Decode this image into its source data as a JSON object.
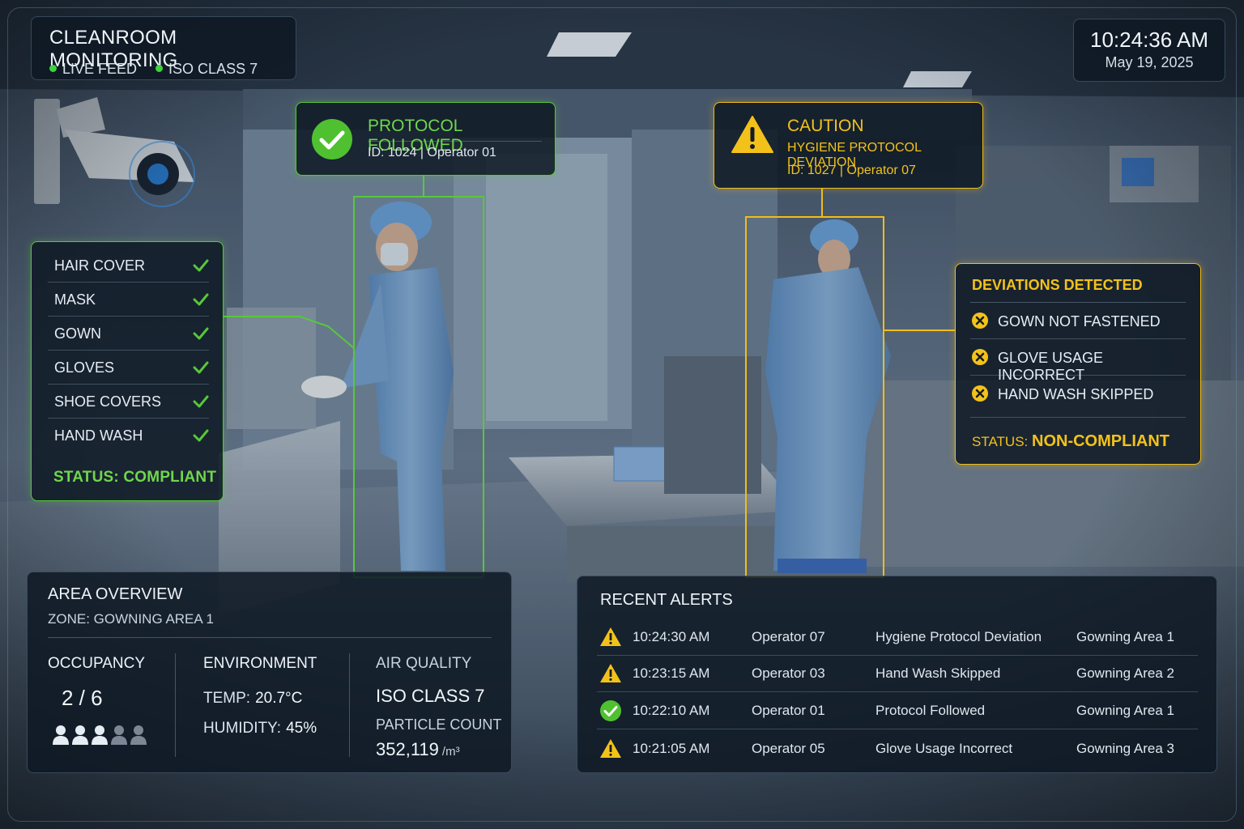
{
  "header": {
    "title": "CLEANROOM MONITORING",
    "tags": [
      "LIVE FEED",
      "ISO CLASS 7"
    ]
  },
  "clock": {
    "time": "10:24:36 AM",
    "date": "May 19, 2025"
  },
  "colors": {
    "compliant": "#6fd74b",
    "caution": "#f3c21a",
    "panel": "#0e1824"
  },
  "operator_ok": {
    "title": "PROTOCOL FOLLOWED",
    "subtitle": "ID: 1024 | Operator 01",
    "icon": "check-circle-icon"
  },
  "operator_warn": {
    "title": "CAUTION",
    "message": "HYGIENE PROTOCOL DEVIATION",
    "subtitle": "ID: 1027 | Operator 07",
    "icon": "warning-triangle-icon"
  },
  "checklist": {
    "items": [
      {
        "label": "HAIR COVER",
        "icon": "check-icon"
      },
      {
        "label": "MASK",
        "icon": "check-icon"
      },
      {
        "label": "GOWN",
        "icon": "check-icon"
      },
      {
        "label": "GLOVES",
        "icon": "check-icon"
      },
      {
        "label": "SHOE COVERS",
        "icon": "check-icon"
      },
      {
        "label": "HAND WASH",
        "icon": "check-icon"
      }
    ],
    "status": "STATUS: COMPLIANT"
  },
  "deviations": {
    "title": "DEVIATIONS DETECTED",
    "items": [
      {
        "label": "GOWN NOT FASTENED",
        "icon": "x-circle-icon"
      },
      {
        "label": "GLOVE USAGE INCORRECT",
        "icon": "x-circle-icon"
      },
      {
        "label": "HAND WASH SKIPPED",
        "icon": "x-circle-icon"
      }
    ],
    "status_label": "STATUS:",
    "status_value": "NON-COMPLIANT"
  },
  "overview": {
    "title": "AREA OVERVIEW",
    "zone": "ZONE: GOWNING AREA 1",
    "occupancy": {
      "label": "OCCUPANCY",
      "value": "2 / 6",
      "current": 2,
      "max": 6,
      "icons_shown": 5,
      "icons_active": 3
    },
    "environment": {
      "label": "ENVIRONMENT",
      "temp_label": "TEMP:",
      "temp_value": "20.7°C",
      "humidity_label": "HUMIDITY:",
      "humidity_value": "45%"
    },
    "air_quality": {
      "label": "AIR QUALITY",
      "class": "ISO CLASS 7",
      "particle_label": "PARTICLE COUNT",
      "particle_value": "352,119",
      "particle_unit": "/m³"
    }
  },
  "alerts": {
    "title": "RECENT ALERTS",
    "rows": [
      {
        "type": "warning",
        "icon": "warning-triangle-icon",
        "time": "10:24:30 AM",
        "operator": "Operator 07",
        "message": "Hygiene Protocol Deviation",
        "area": "Gowning Area 1"
      },
      {
        "type": "warning",
        "icon": "warning-triangle-icon",
        "time": "10:23:15 AM",
        "operator": "Operator 03",
        "message": "Hand Wash Skipped",
        "area": "Gowning Area 2"
      },
      {
        "type": "ok",
        "icon": "check-circle-icon",
        "time": "10:22:10 AM",
        "operator": "Operator 01",
        "message": "Protocol Followed",
        "area": "Gowning Area 1"
      },
      {
        "type": "warning",
        "icon": "warning-triangle-icon",
        "time": "10:21:05 AM",
        "operator": "Operator 05",
        "message": "Glove Usage Incorrect",
        "area": "Gowning Area 3"
      }
    ]
  }
}
